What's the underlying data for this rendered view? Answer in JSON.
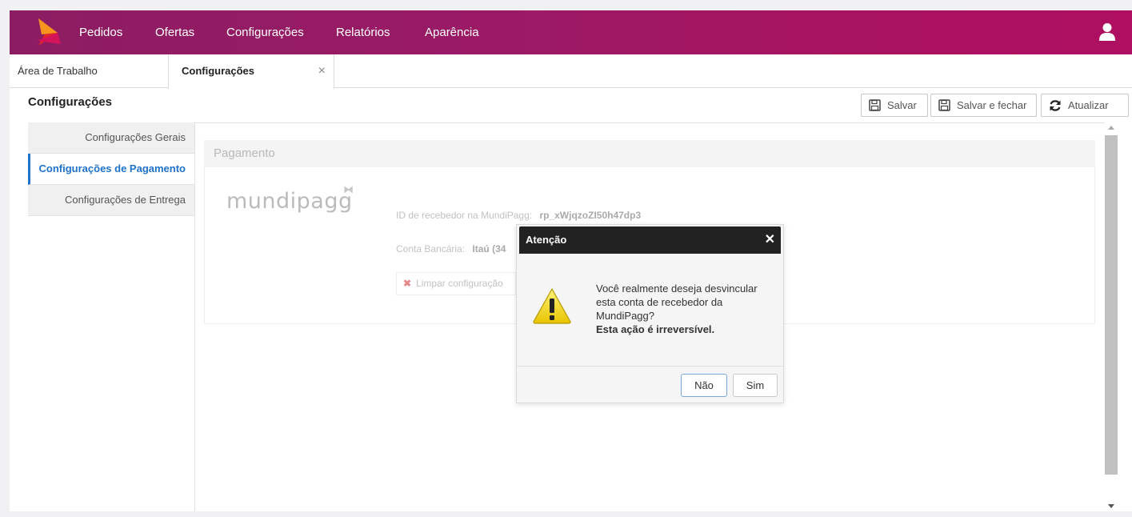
{
  "nav": {
    "items": [
      {
        "label": "Pedidos"
      },
      {
        "label": "Ofertas"
      },
      {
        "label": "Configurações"
      },
      {
        "label": "Relatórios"
      },
      {
        "label": "Aparência"
      }
    ]
  },
  "tabs": [
    {
      "label": "Área de Trabalho"
    },
    {
      "label": "Configurações",
      "close": "×"
    }
  ],
  "page": {
    "title": "Configurações",
    "actions": {
      "save": "Salvar",
      "save_close": "Salvar e fechar",
      "refresh": "Atualizar"
    }
  },
  "sidebar": {
    "items": [
      {
        "label": "Configurações Gerais"
      },
      {
        "label": "Configurações de Pagamento",
        "active": true
      },
      {
        "label": "Configurações de Entrega"
      }
    ]
  },
  "payment": {
    "heading": "Pagamento",
    "logo_text": "mundipagg",
    "receiver_label": "ID de recebedor na MundiPagg:",
    "receiver_value": "rp_xWjqzoZI50h47dp3",
    "bank_label": "Conta Bancária:",
    "bank_value": "Itaú (34",
    "clear_label": "Limpar configuração"
  },
  "dialog": {
    "title": "Atenção",
    "close": "✕",
    "message": "Você realmente deseja desvincular esta conta de recebedor da MundiPagg?",
    "warning": "Esta ação é irreversível.",
    "no": "Não",
    "yes": "Sim"
  },
  "colors": {
    "brand": "#9b1a66",
    "active": "#1f72c8",
    "dialog_header": "#222222"
  }
}
